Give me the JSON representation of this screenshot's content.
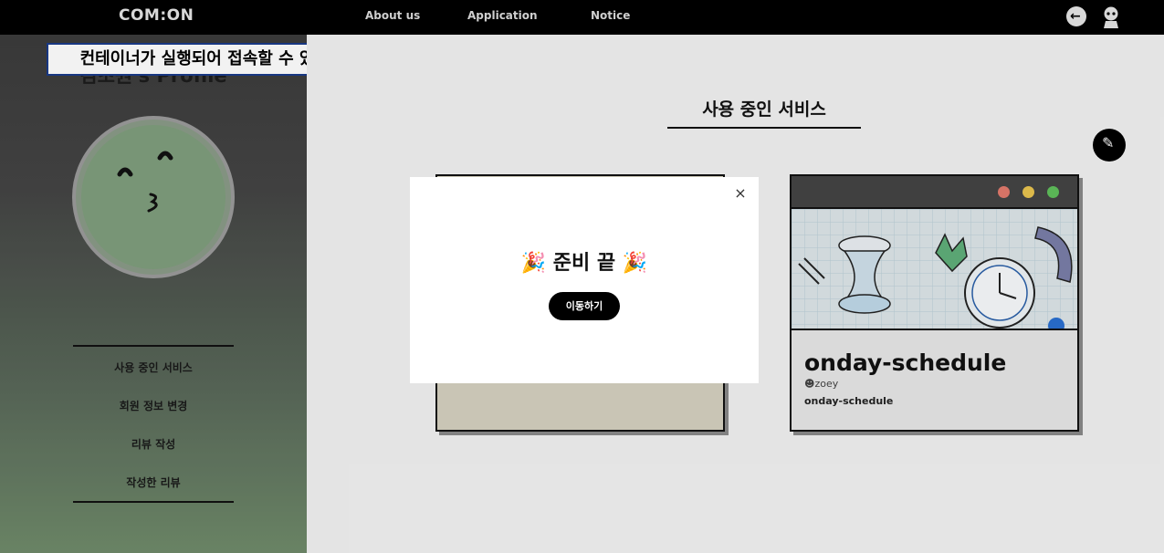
{
  "header": {
    "logo": "COM:ON",
    "nav": [
      "About us",
      "Application",
      "Notice"
    ]
  },
  "annotation": "컨테이너가 실행되어 접속할 수 있는 경우",
  "sidebar": {
    "profile_title": "김초원's Profile",
    "menu": [
      "사용 중인 서비스",
      "회원 정보 변경",
      "리뷰 작성",
      "작성한 리뷰"
    ]
  },
  "main": {
    "section_title": "사용 중인 서비스",
    "cards": [
      {
        "title": "onday-schedule",
        "author": "zoey",
        "subtitle": "onday-schedule"
      }
    ]
  },
  "modal": {
    "title": "준비 끝",
    "button": "이동하기",
    "close_label": "×"
  },
  "colors": {
    "window_dot_red": "#e27a6c",
    "window_dot_yellow": "#e8c34f",
    "window_dot_green": "#5fbf5b",
    "avatar_green": "#7f9e7d"
  }
}
